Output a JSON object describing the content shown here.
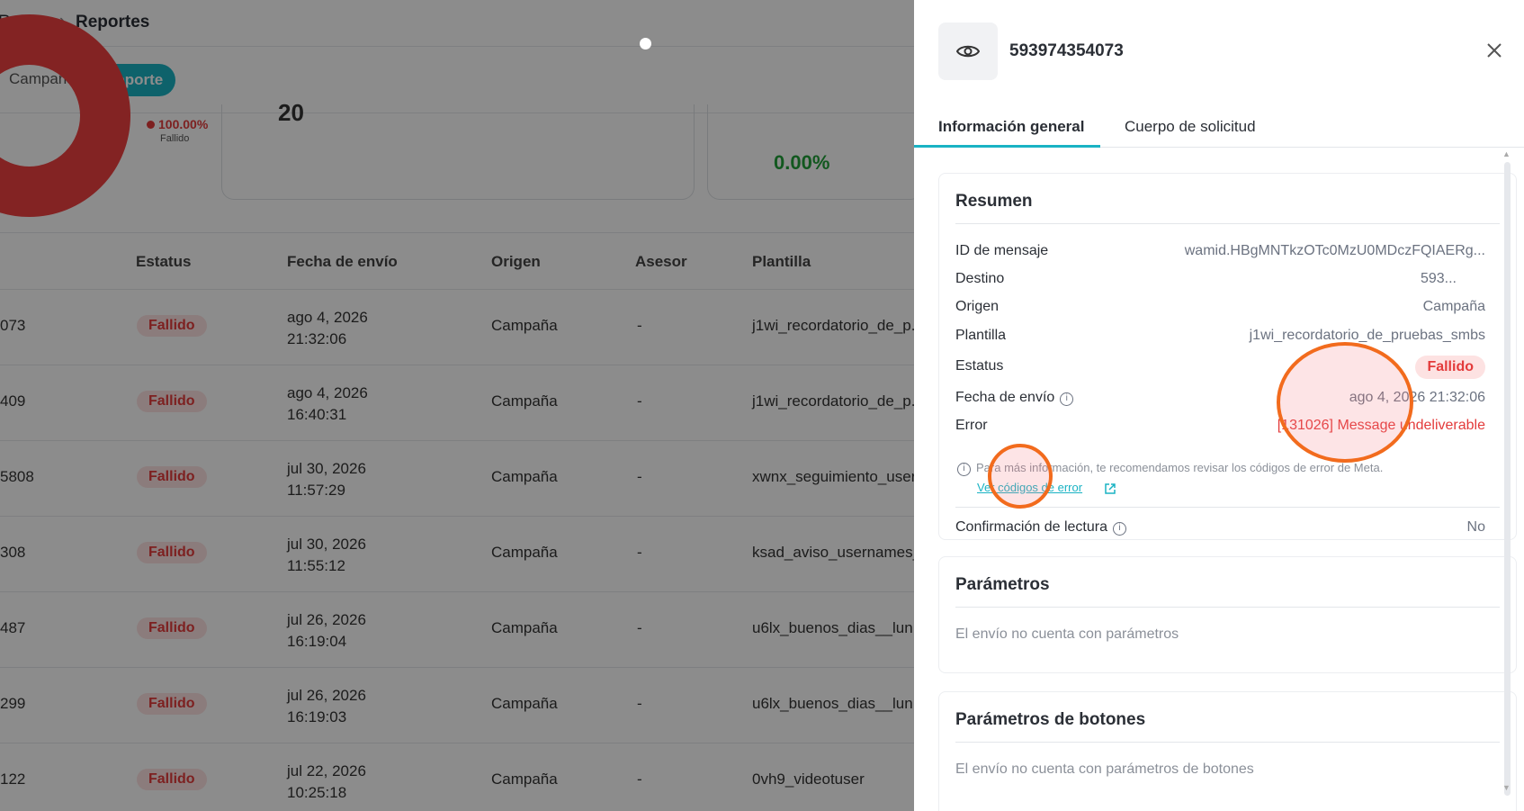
{
  "header": {
    "app_crumb": "Re…",
    "current_crumb": "Reportes"
  },
  "page_tabs": {
    "campaigns": "Campañas",
    "report": "Reporte"
  },
  "stats": {
    "failed_pct": "100.00%",
    "failed_label": "Fallido",
    "card1_value": "20",
    "card2_value": "0.00%"
  },
  "table": {
    "columns": [
      "Estatus",
      "Fecha de envío",
      "Origen",
      "Asesor",
      "Plantilla"
    ],
    "rows": [
      {
        "id": "073",
        "status": "Fallido",
        "date": "ago 4, 2026",
        "time": "21:32:06",
        "origin": "Campaña",
        "advisor": "-",
        "template": "j1wi_recordatorio_de_p..."
      },
      {
        "id": "409",
        "status": "Fallido",
        "date": "ago 4, 2026",
        "time": "16:40:31",
        "origin": "Campaña",
        "advisor": "-",
        "template": "j1wi_recordatorio_de_p..."
      },
      {
        "id": "5808",
        "status": "Fallido",
        "date": "jul 30, 2026",
        "time": "11:57:29",
        "origin": "Campaña",
        "advisor": "-",
        "template": "xwnx_seguimiento_user"
      },
      {
        "id": "308",
        "status": "Fallido",
        "date": "jul 30, 2026",
        "time": "11:55:12",
        "origin": "Campaña",
        "advisor": "-",
        "template": "ksad_aviso_usernames_"
      },
      {
        "id": "487",
        "status": "Fallido",
        "date": "jul 26, 2026",
        "time": "16:19:04",
        "origin": "Campaña",
        "advisor": "-",
        "template": "u6lx_buenos_dias__lun"
      },
      {
        "id": "299",
        "status": "Fallido",
        "date": "jul 26, 2026",
        "time": "16:19:03",
        "origin": "Campaña",
        "advisor": "-",
        "template": "u6lx_buenos_dias__lun"
      },
      {
        "id": "122",
        "status": "Fallido",
        "date": "jul 22, 2026",
        "time": "10:25:18",
        "origin": "Campaña",
        "advisor": "-",
        "template": "0vh9_videotuser"
      }
    ]
  },
  "drawer": {
    "title": "593974354073",
    "tabs": [
      "Información general",
      "Cuerpo de solicitud"
    ],
    "summary": {
      "title": "Resumen",
      "message_id_label": "ID de mensaje",
      "message_id_value": "wamid.HBgMNTkzOTc0MzU0MDczFQIAERg...",
      "destination_label": "Destino",
      "destination_value": "593...",
      "origin_label": "Origen",
      "origin_value": "Campaña",
      "template_label": "Plantilla",
      "template_value": "j1wi_recordatorio_de_pruebas_smbs",
      "status_label": "Estatus",
      "status_value": "Fallido",
      "date_label": "Fecha de envío",
      "date_value": "ago 4, 2026 21:32:06",
      "error_label": "Error",
      "error_value": "[131026] Message undeliverable",
      "note": "Para más información, te recomendamos revisar los códigos de error de Meta.",
      "note_link": "Ver códigos de error",
      "read_label": "Confirmación de lectura",
      "read_value": "No"
    },
    "params": {
      "title": "Parámetros",
      "empty": "El envío no cuenta con parámetros"
    },
    "button_params": {
      "title": "Parámetros de botones",
      "empty": "El envío no cuenta con parámetros de botones"
    }
  },
  "colors": {
    "accent": "#1ab3c4",
    "error": "#e33b3b",
    "highlight": "#f26b1d"
  }
}
